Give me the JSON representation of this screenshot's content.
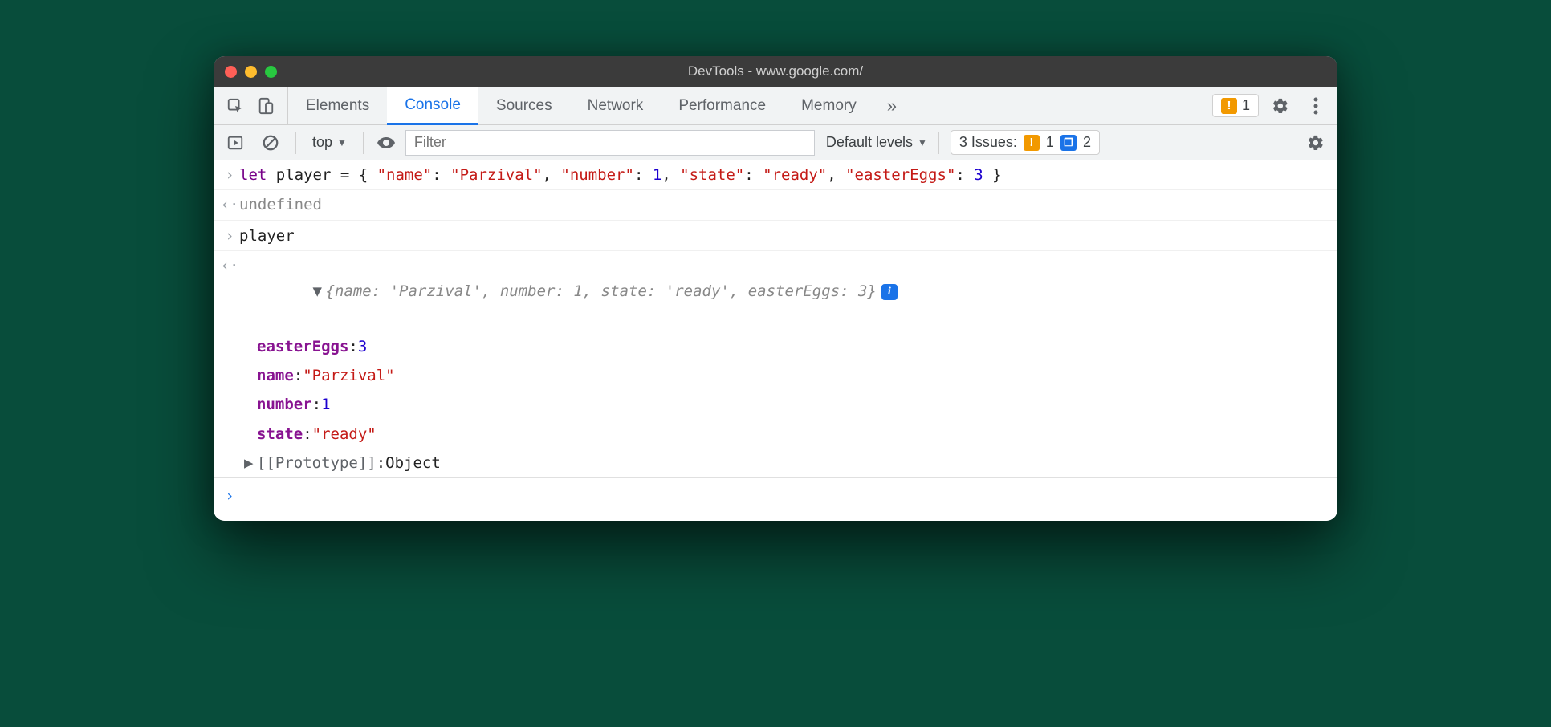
{
  "window": {
    "title": "DevTools - www.google.com/"
  },
  "tabs": {
    "items": [
      "Elements",
      "Console",
      "Sources",
      "Network",
      "Performance",
      "Memory"
    ],
    "active_index": 1,
    "overflow_glyph": "»"
  },
  "warning_badge": {
    "count": "1"
  },
  "toolbar": {
    "context": "top",
    "filter_placeholder": "Filter",
    "levels_label": "Default levels",
    "issues": {
      "label": "3 Issues:",
      "warn_count": "1",
      "info_count": "2"
    }
  },
  "console": {
    "line1": {
      "kw": "let",
      "var": " player = { ",
      "k1": "\"name\"",
      "c1": ": ",
      "v1": "\"Parzival\"",
      "sep1": ", ",
      "k2": "\"number\"",
      "c2": ": ",
      "v2": "1",
      "sep2": ", ",
      "k3": "\"state\"",
      "c3": ": ",
      "v3": "\"ready\"",
      "sep3": ", ",
      "k4": "\"easterEggs\"",
      "c4": ": ",
      "v4": "3",
      "end": " }"
    },
    "undef": "undefined",
    "line2": "player",
    "summary": "{name: 'Parzival', number: 1, state: 'ready', easterEggs: 3}",
    "props": {
      "p1k": "easterEggs",
      "p1c": ": ",
      "p1v": "3",
      "p2k": "name",
      "p2c": ": ",
      "p2v": "\"Parzival\"",
      "p3k": "number",
      "p3c": ": ",
      "p3v": "1",
      "p4k": "state",
      "p4c": ": ",
      "p4v": "\"ready\""
    },
    "proto_label": "[[Prototype]]",
    "proto_sep": ": ",
    "proto_value": "Object"
  },
  "glyphs": {
    "input_prompt": "›",
    "output_prompt": "‹·",
    "tri_down": "▼",
    "tri_right": "▶"
  }
}
